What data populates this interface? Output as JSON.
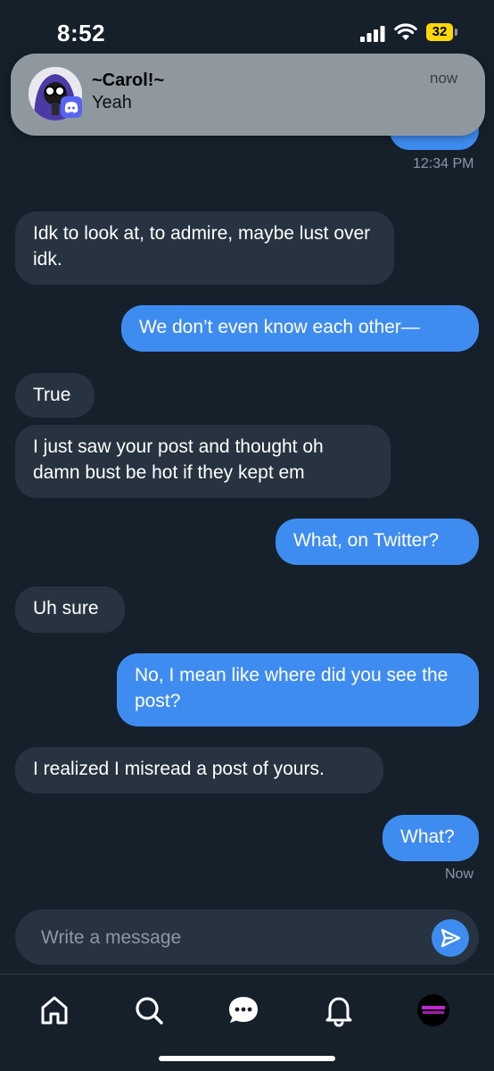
{
  "status_bar": {
    "time": "8:52",
    "battery": "32"
  },
  "notification": {
    "sender": "~Carol!~",
    "message": "Yeah",
    "time": "now",
    "app_icon": "discord-icon"
  },
  "messages": [
    {
      "direction": "outgoing",
      "text": "",
      "note": "partially hidden bubble"
    },
    {
      "direction": "timestamp",
      "text": "12:34 PM"
    },
    {
      "direction": "incoming",
      "text": "Idk to look at, to admire, maybe lust over idk."
    },
    {
      "direction": "outgoing",
      "text": "We don’t even know each other—"
    },
    {
      "direction": "incoming",
      "text": "True"
    },
    {
      "direction": "incoming",
      "text": "I just saw your post and thought oh damn bust be hot if they kept em"
    },
    {
      "direction": "outgoing",
      "text": "What, on Twitter?"
    },
    {
      "direction": "incoming",
      "text": "Uh sure"
    },
    {
      "direction": "outgoing",
      "text": "No, I mean like where did you see the post?"
    },
    {
      "direction": "incoming",
      "text": "I realized I misread a post of yours."
    },
    {
      "direction": "outgoing",
      "text": "What?"
    },
    {
      "direction": "timestamp",
      "text": "Now"
    }
  ],
  "composer": {
    "placeholder": "Write a message",
    "send_icon": "send-icon"
  },
  "tabbar": {
    "tabs": [
      "home-icon",
      "search-icon",
      "messages-icon",
      "notifications-icon",
      "profile-avatar"
    ]
  },
  "colors": {
    "background": "#15202b",
    "incoming_bubble": "#273340",
    "outgoing_bubble": "#3f8cf0",
    "accent": "#3f8cf0"
  }
}
